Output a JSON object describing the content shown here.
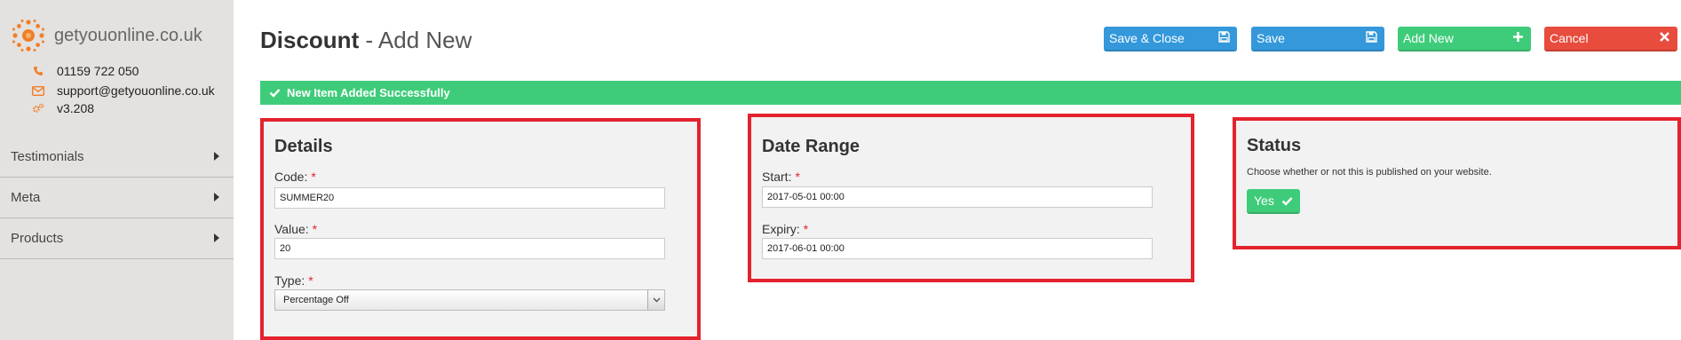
{
  "brand": {
    "name": "getyouonline.co.uk",
    "phone": "01159 722 050",
    "email": "support@getyouonline.co.uk",
    "version": "v3.208"
  },
  "sidebar": {
    "items": [
      {
        "label": "Testimonials"
      },
      {
        "label": "Meta"
      },
      {
        "label": "Products"
      }
    ]
  },
  "header": {
    "title": "Discount",
    "subtitle": "- Add New"
  },
  "toolbar": {
    "save_close": "Save & Close",
    "save": "Save",
    "add_new": "Add New",
    "cancel": "Cancel"
  },
  "alert": {
    "message": "New Item Added Successfully"
  },
  "details": {
    "title": "Details",
    "code": {
      "label": "Code:",
      "value": "SUMMER20"
    },
    "value": {
      "label": "Value:",
      "value": "20"
    },
    "type": {
      "label": "Type:",
      "selected": "Percentage Off"
    }
  },
  "date_range": {
    "title": "Date Range",
    "start": {
      "label": "Start:",
      "value": "2017-05-01 00:00"
    },
    "expiry": {
      "label": "Expiry:",
      "value": "2017-06-01 00:00"
    }
  },
  "status": {
    "title": "Status",
    "description": "Choose whether or not this is published on your website.",
    "toggle_label": "Yes"
  },
  "required_marker": "*",
  "colors": {
    "accent_blue": "#3498db",
    "success_green": "#3fcc7a",
    "danger_red": "#e74c3c",
    "highlight_border": "#e3232e",
    "brand_orange": "#f07f2a"
  },
  "icons": {
    "logo": "sun-logo-icon",
    "phone": "phone-icon",
    "email": "envelope-icon",
    "version": "gears-icon",
    "save": "floppy-disk-icon",
    "add": "plus-icon",
    "cancel": "close-icon",
    "check": "check-icon",
    "nav_arrow": "caret-right-icon",
    "select_caret": "chevron-down-icon"
  }
}
